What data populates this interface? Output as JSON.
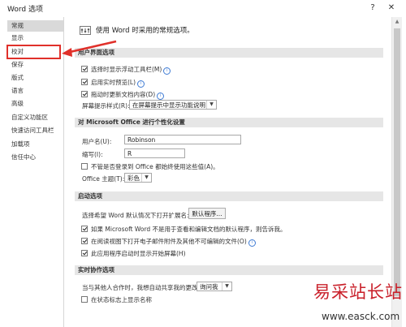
{
  "window": {
    "title": "Word 选项",
    "help": "?",
    "close": "✕"
  },
  "sidebar": {
    "items": [
      {
        "label": "常规"
      },
      {
        "label": "显示"
      },
      {
        "label": "校对"
      },
      {
        "label": "保存"
      },
      {
        "label": "版式"
      },
      {
        "label": "语言"
      },
      {
        "label": "高级"
      },
      {
        "label": "自定义功能区"
      },
      {
        "label": "快速访问工具栏"
      },
      {
        "label": "加载项"
      },
      {
        "label": "信任中心"
      }
    ],
    "active_index": 0,
    "highlighted_index": 2
  },
  "hero": {
    "text": "使用 Word 时采用的常规选项。"
  },
  "section_ui": {
    "title": "用户界面选项",
    "opt1": "选择时显示浮动工具栏(M)",
    "opt2": "启用实时预览(L)",
    "opt3": "拖动时更新文档内容(D)",
    "tooltip_label": "屏幕提示样式(R):",
    "tooltip_value": "在屏幕提示中显示功能说明"
  },
  "section_personalize": {
    "title": "对 Microsoft Office 进行个性化设置",
    "username_label": "用户名(U):",
    "username_value": "Robinson",
    "initials_label": "缩写(I):",
    "initials_value": "R",
    "always_use": "不管是否登录到 Office 都始终使用这些值(A)。",
    "theme_label": "Office 主题(T):",
    "theme_value": "彩色"
  },
  "section_startup": {
    "title": "启动选项",
    "ext_label": "选择希望 Word 默认情况下打开扩展名:",
    "default_programs": "默认程序...",
    "opt1": "如果 Microsoft Word 不是用于查看和编辑文档的默认程序，则告诉我。",
    "opt2": "在阅读视图下打开电子邮件附件及其他不可编辑的文件(O)",
    "opt3": "此应用程序启动时显示开始屏幕(H)"
  },
  "section_realtime": {
    "title": "实时协作选项",
    "share_label": "当与其他人合作时，我想自动共享我的更改:",
    "share_value": "询问我",
    "show_names": "在状态标志上显示名称"
  },
  "watermark": {
    "brand": "易采站长站",
    "url": "www.easck.com"
  }
}
